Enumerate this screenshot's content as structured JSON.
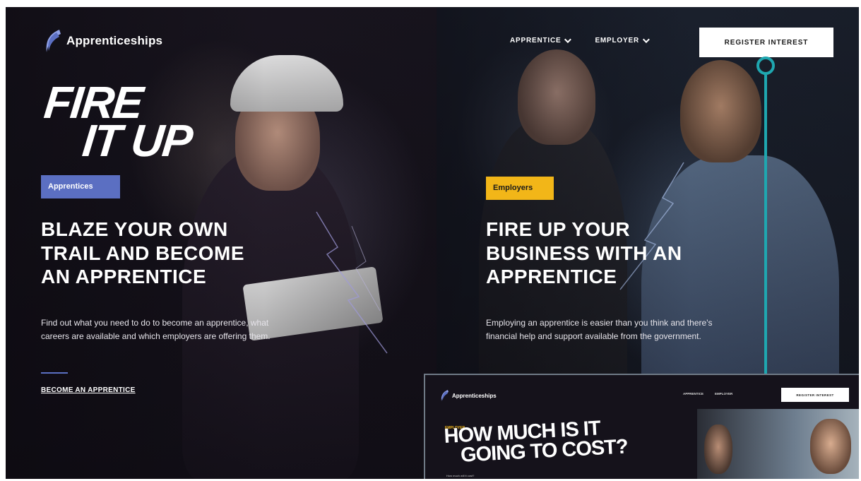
{
  "header": {
    "logo_text": "Apprenticeships",
    "nav": [
      {
        "label": "APPRENTICE"
      },
      {
        "label": "EMPLOYER"
      }
    ],
    "register_label": "REGISTER INTEREST"
  },
  "hero": {
    "line1": "FIRE",
    "line2": "IT UP"
  },
  "apprentices": {
    "tag": "Apprentices",
    "headline": "BLAZE YOUR OWN TRAIL AND BECOME AN APPRENTICE",
    "body": "Find out what you need to do to become an apprentice, what careers are available and which employers are offering them.",
    "cta": "BECOME AN APPRENTICE"
  },
  "employers": {
    "tag": "Employers",
    "headline": "FIRE UP YOUR BUSINESS WITH AN APPRENTICE",
    "body": "Employing an apprentice is easier than you think and there's financial help and support available from the government."
  },
  "inset": {
    "logo_text": "Apprenticeships",
    "nav": [
      {
        "label": "APPRENTICE"
      },
      {
        "label": "EMPLOYER"
      }
    ],
    "register_label": "REGISTER INTEREST",
    "eyebrow": "EMPLOYER",
    "heading_line1": "HOW MUCH IS IT",
    "heading_line2": "GOING TO COST?",
    "sub": "How much will it cost?"
  },
  "colors": {
    "apprentices_tag": "#5b6fc2",
    "employers_tag": "#f2b618",
    "callout": "#1fa7b0"
  }
}
